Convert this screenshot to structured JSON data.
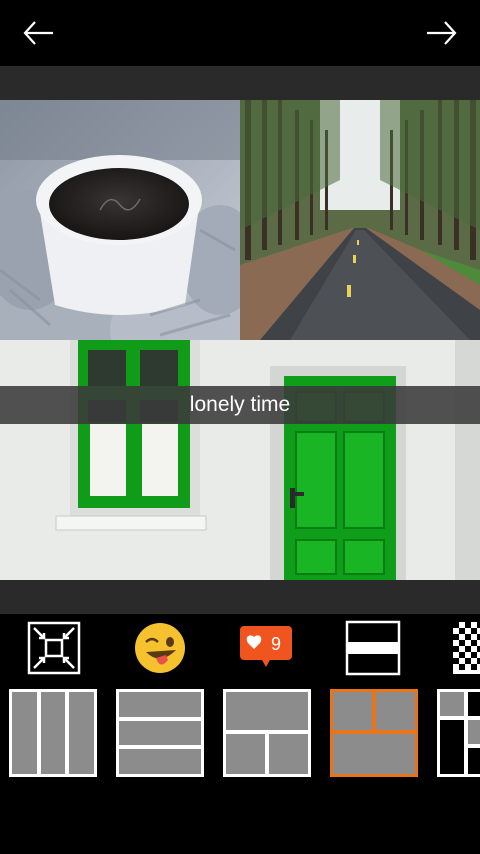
{
  "topbar": {
    "back_icon": "arrow-left-icon",
    "forward_icon": "arrow-right-icon"
  },
  "collage": {
    "caption": "lonely time",
    "photos": [
      "coffee-cup-photo",
      "forest-road-photo",
      "green-door-photo"
    ]
  },
  "tools": {
    "items": [
      "fit-icon",
      "emoji-sticker-icon",
      "like-badge-icon",
      "split-frame-icon",
      "pattern-icon"
    ],
    "like_count": "9"
  },
  "layouts": {
    "items": [
      "layout-3-columns",
      "layout-3-rows",
      "layout-top-two-bottom",
      "layout-two-top-one-bottom",
      "layout-mixed"
    ],
    "selected_index": 3,
    "accent_color": "#e8751a"
  },
  "colors": {
    "background": "#000000",
    "canvas": "#2a2a2a",
    "caption_band": "#3a3a3a",
    "layout_fill": "#8c8c8c"
  }
}
